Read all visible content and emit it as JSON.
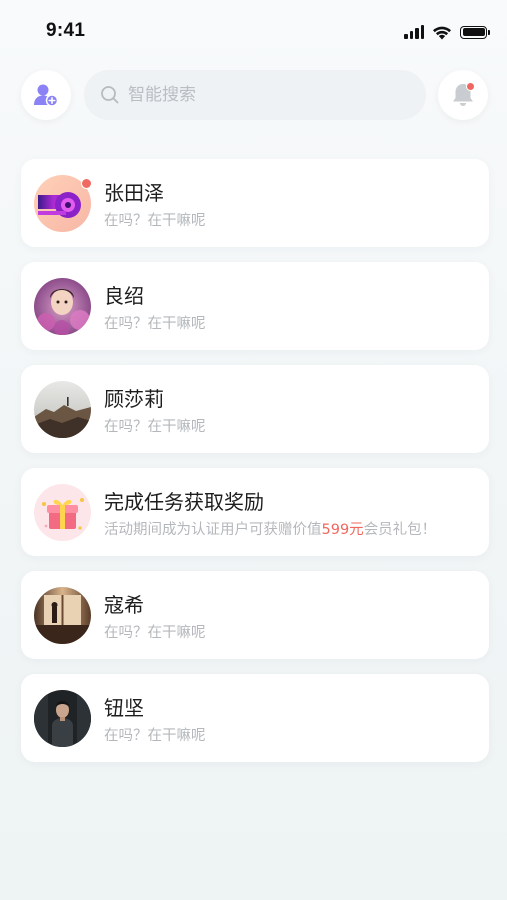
{
  "status_bar": {
    "time": "9:41"
  },
  "header": {
    "search_placeholder": "智能搜索",
    "add_friend_icon": "add-friend-icon",
    "bell_icon": "bell-icon"
  },
  "colors": {
    "accent_purple": "#8b82f6",
    "badge_red": "#f0675f"
  },
  "conversations": [
    {
      "name": "张田泽",
      "message": "在吗？在干嘛呢",
      "unread": true
    },
    {
      "name": "良绍",
      "message": "在吗？在干嘛呢",
      "unread": false
    },
    {
      "name": "顾莎莉",
      "message": "在吗？在干嘛呢",
      "unread": false
    },
    {
      "name": "完成任务获取奖励",
      "message_prefix": "活动期间成为认证用户可获赠价值",
      "message_highlight": "599元",
      "message_suffix": "会员礼包！",
      "icon": "gift-icon"
    },
    {
      "name": "寇希",
      "message": "在吗？在干嘛呢",
      "unread": false
    },
    {
      "name": "钮坚",
      "message": "在吗？在干嘛呢",
      "unread": false
    }
  ]
}
